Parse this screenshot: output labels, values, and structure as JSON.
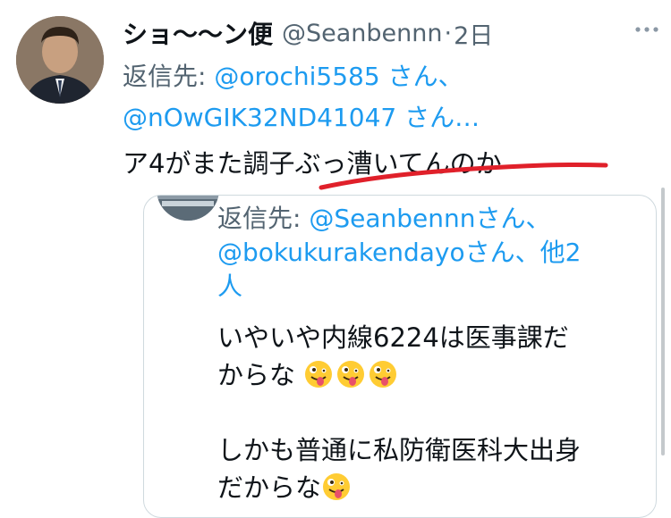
{
  "tweet": {
    "display_name": "ショ〜〜ン便",
    "handle": "@Seanbennn",
    "separator": "·",
    "time": "2日",
    "reply_label": "返信先:",
    "reply_mention_1": "@orochi5585",
    "reply_san_1": " さん、",
    "reply_mention_2": "@nOwGIK32ND41047",
    "reply_san_2": " さん…",
    "text": "ア4がまた調子ぶっ漕いてんのか",
    "avatar_icon": "person-avatar",
    "more_icon": "ellipsis-icon"
  },
  "quoted": {
    "reply_label": "返信先: ",
    "mention_1": "@Seanbennn",
    "san_1": "さん、",
    "mention_2": "@bokukurakendayo",
    "san_2": "さん、",
    "others": "他2",
    "others_tail": "人",
    "line_1": "いやいや内線6224は医事課だ",
    "line_2": "からな",
    "line_3": "しかも普通に私防衛医科大出身",
    "line_4": "だからな",
    "emoji_icon": "zany-face-emoji"
  },
  "colors": {
    "link": "#1d9bf0",
    "secondary_text": "#536471",
    "underline": "#e0202a"
  }
}
